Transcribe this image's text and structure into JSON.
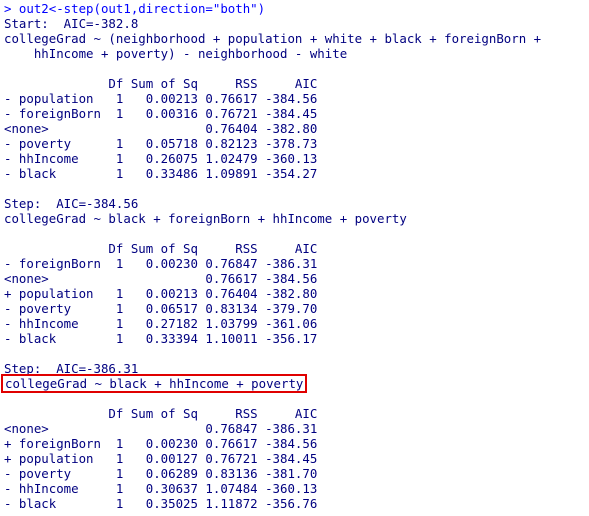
{
  "console": {
    "lines": [
      {
        "text": "> out2<-step(out1,direction=\"both\")",
        "kind": "cmd"
      },
      {
        "text": "Start:  AIC=-382.8",
        "kind": "out"
      },
      {
        "text": "collegeGrad ~ (neighborhood + population + white + black + foreignBorn +",
        "kind": "out"
      },
      {
        "text": "    hhIncome + poverty) - neighborhood - white",
        "kind": "out"
      },
      {
        "text": "",
        "kind": "blank"
      },
      {
        "text": "              Df Sum of Sq     RSS     AIC",
        "kind": "out"
      },
      {
        "text": "- population   1   0.00213 0.76617 -384.56",
        "kind": "out"
      },
      {
        "text": "- foreignBorn  1   0.00316 0.76721 -384.45",
        "kind": "out"
      },
      {
        "text": "<none>                     0.76404 -382.80",
        "kind": "out"
      },
      {
        "text": "- poverty      1   0.05718 0.82123 -378.73",
        "kind": "out"
      },
      {
        "text": "- hhIncome     1   0.26075 1.02479 -360.13",
        "kind": "out"
      },
      {
        "text": "- black        1   0.33486 1.09891 -354.27",
        "kind": "out"
      },
      {
        "text": "",
        "kind": "blank"
      },
      {
        "text": "Step:  AIC=-384.56",
        "kind": "out"
      },
      {
        "text": "collegeGrad ~ black + foreignBorn + hhIncome + poverty",
        "kind": "out"
      },
      {
        "text": "",
        "kind": "blank"
      },
      {
        "text": "              Df Sum of Sq     RSS     AIC",
        "kind": "out"
      },
      {
        "text": "- foreignBorn  1   0.00230 0.76847 -386.31",
        "kind": "out"
      },
      {
        "text": "<none>                     0.76617 -384.56",
        "kind": "out"
      },
      {
        "text": "+ population   1   0.00213 0.76404 -382.80",
        "kind": "out"
      },
      {
        "text": "- poverty      1   0.06517 0.83134 -379.70",
        "kind": "out"
      },
      {
        "text": "- hhIncome     1   0.27182 1.03799 -361.06",
        "kind": "out"
      },
      {
        "text": "- black        1   0.33394 1.10011 -356.17",
        "kind": "out"
      },
      {
        "text": "",
        "kind": "blank"
      },
      {
        "text": "Step:  AIC=-386.31",
        "kind": "out"
      },
      {
        "text": "collegeGrad ~ black + hhIncome + poverty",
        "kind": "highlight"
      },
      {
        "text": "",
        "kind": "blank"
      },
      {
        "text": "              Df Sum of Sq     RSS     AIC",
        "kind": "out"
      },
      {
        "text": "<none>                     0.76847 -386.31",
        "kind": "out"
      },
      {
        "text": "+ foreignBorn  1   0.00230 0.76617 -384.56",
        "kind": "out"
      },
      {
        "text": "+ population   1   0.00127 0.76721 -384.45",
        "kind": "out"
      },
      {
        "text": "- poverty      1   0.06289 0.83136 -381.70",
        "kind": "out"
      },
      {
        "text": "- hhIncome     1   0.30637 1.07484 -360.13",
        "kind": "out"
      },
      {
        "text": "- black        1   0.35025 1.11872 -356.76",
        "kind": "out"
      }
    ]
  },
  "colors": {
    "command": "#0000ff",
    "output": "#000080",
    "highlight_border": "#e00000",
    "background": "#ffffff"
  }
}
